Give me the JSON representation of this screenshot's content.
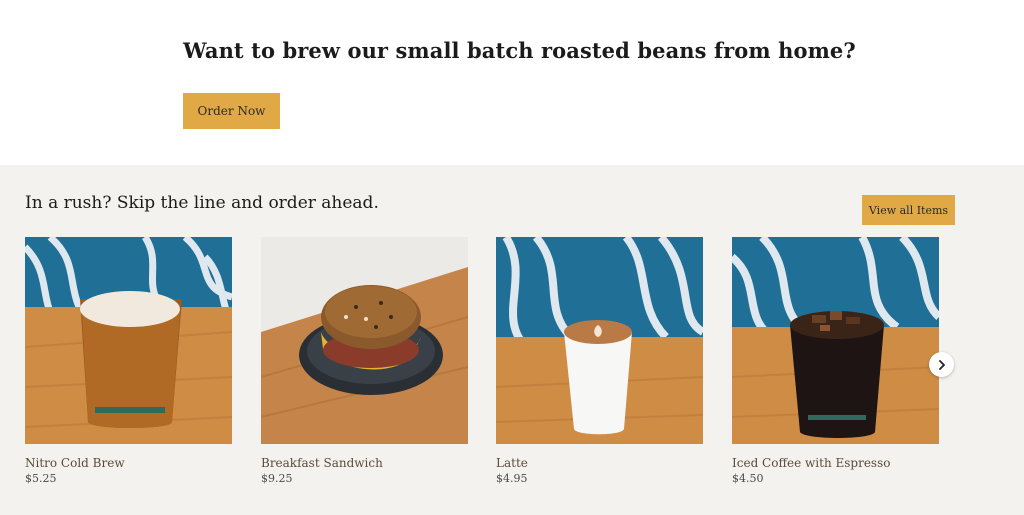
{
  "promo": {
    "headline": "Want to brew our small batch roasted beans from home?",
    "order_button": "Order Now"
  },
  "order_ahead": {
    "title": "In a rush? Skip the line and order ahead.",
    "view_all_button": "View all Items",
    "next_icon": "chevron-right-icon",
    "items": [
      {
        "name": "Nitro Cold Brew",
        "price": "$5.25"
      },
      {
        "name": "Breakfast Sandwich",
        "price": "$9.25"
      },
      {
        "name": "Latte",
        "price": "$4.95"
      },
      {
        "name": "Iced Coffee with Espresso",
        "price": "$4.50"
      }
    ]
  },
  "colors": {
    "accent": "#e0a945",
    "band_background": "#f4f2ee",
    "mural_blue": "#1f6f96",
    "wood": "#c98a45"
  }
}
